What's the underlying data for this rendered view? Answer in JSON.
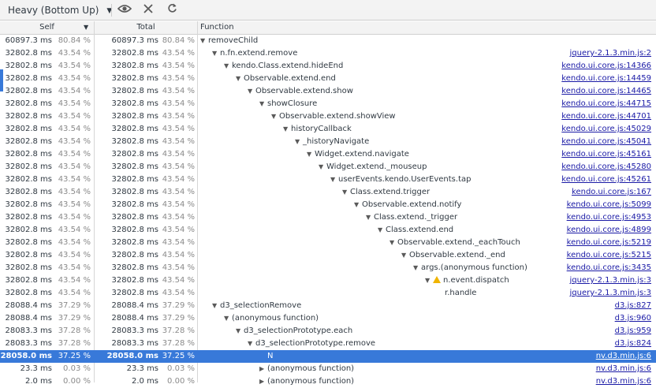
{
  "toolbar": {
    "view_select": "Heavy (Bottom Up)",
    "eye_icon": "eye-icon",
    "close_icon": "close-icon",
    "refresh_icon": "refresh-icon"
  },
  "columns": {
    "self": "Self",
    "total": "Total",
    "function": "Function"
  },
  "rows": [
    {
      "self_ms": "60897.3 ms",
      "self_pct": "80.84 %",
      "total_ms": "60897.3 ms",
      "total_pct": "80.84 %",
      "depth": 0,
      "arrow": "down",
      "name": "removeChild",
      "url": ""
    },
    {
      "self_ms": "32802.8 ms",
      "self_pct": "43.54 %",
      "total_ms": "32802.8 ms",
      "total_pct": "43.54 %",
      "depth": 1,
      "arrow": "down",
      "name": "n.fn.extend.remove",
      "url": "jquery-2.1.3.min.js:2"
    },
    {
      "self_ms": "32802.8 ms",
      "self_pct": "43.54 %",
      "total_ms": "32802.8 ms",
      "total_pct": "43.54 %",
      "depth": 2,
      "arrow": "down",
      "name": "kendo.Class.extend.hideEnd",
      "url": "kendo.ui.core.js:14366"
    },
    {
      "self_ms": "32802.8 ms",
      "self_pct": "43.54 %",
      "total_ms": "32802.8 ms",
      "total_pct": "43.54 %",
      "depth": 3,
      "arrow": "down",
      "name": "Observable.extend.end",
      "url": "kendo.ui.core.js:14459"
    },
    {
      "self_ms": "32802.8 ms",
      "self_pct": "43.54 %",
      "total_ms": "32802.8 ms",
      "total_pct": "43.54 %",
      "depth": 4,
      "arrow": "down",
      "name": "Observable.extend.show",
      "url": "kendo.ui.core.js:14465"
    },
    {
      "self_ms": "32802.8 ms",
      "self_pct": "43.54 %",
      "total_ms": "32802.8 ms",
      "total_pct": "43.54 %",
      "depth": 5,
      "arrow": "down",
      "name": "showClosure",
      "url": "kendo.ui.core.js:44715"
    },
    {
      "self_ms": "32802.8 ms",
      "self_pct": "43.54 %",
      "total_ms": "32802.8 ms",
      "total_pct": "43.54 %",
      "depth": 6,
      "arrow": "down",
      "name": "Observable.extend.showView",
      "url": "kendo.ui.core.js:44701"
    },
    {
      "self_ms": "32802.8 ms",
      "self_pct": "43.54 %",
      "total_ms": "32802.8 ms",
      "total_pct": "43.54 %",
      "depth": 7,
      "arrow": "down",
      "name": "historyCallback",
      "url": "kendo.ui.core.js:45029"
    },
    {
      "self_ms": "32802.8 ms",
      "self_pct": "43.54 %",
      "total_ms": "32802.8 ms",
      "total_pct": "43.54 %",
      "depth": 8,
      "arrow": "down",
      "name": "_historyNavigate",
      "url": "kendo.ui.core.js:45041"
    },
    {
      "self_ms": "32802.8 ms",
      "self_pct": "43.54 %",
      "total_ms": "32802.8 ms",
      "total_pct": "43.54 %",
      "depth": 9,
      "arrow": "down",
      "name": "Widget.extend.navigate",
      "url": "kendo.ui.core.js:45161"
    },
    {
      "self_ms": "32802.8 ms",
      "self_pct": "43.54 %",
      "total_ms": "32802.8 ms",
      "total_pct": "43.54 %",
      "depth": 10,
      "arrow": "down",
      "name": "Widget.extend._mouseup",
      "url": "kendo.ui.core.js:45280"
    },
    {
      "self_ms": "32802.8 ms",
      "self_pct": "43.54 %",
      "total_ms": "32802.8 ms",
      "total_pct": "43.54 %",
      "depth": 11,
      "arrow": "down",
      "name": "userEvents.kendo.UserEvents.tap",
      "url": "kendo.ui.core.js:45261"
    },
    {
      "self_ms": "32802.8 ms",
      "self_pct": "43.54 %",
      "total_ms": "32802.8 ms",
      "total_pct": "43.54 %",
      "depth": 12,
      "arrow": "down",
      "name": "Class.extend.trigger",
      "url": "kendo.ui.core.js:167"
    },
    {
      "self_ms": "32802.8 ms",
      "self_pct": "43.54 %",
      "total_ms": "32802.8 ms",
      "total_pct": "43.54 %",
      "depth": 13,
      "arrow": "down",
      "name": "Observable.extend.notify",
      "url": "kendo.ui.core.js:5099"
    },
    {
      "self_ms": "32802.8 ms",
      "self_pct": "43.54 %",
      "total_ms": "32802.8 ms",
      "total_pct": "43.54 %",
      "depth": 14,
      "arrow": "down",
      "name": "Class.extend._trigger",
      "url": "kendo.ui.core.js:4953"
    },
    {
      "self_ms": "32802.8 ms",
      "self_pct": "43.54 %",
      "total_ms": "32802.8 ms",
      "total_pct": "43.54 %",
      "depth": 15,
      "arrow": "down",
      "name": "Class.extend.end",
      "url": "kendo.ui.core.js:4899"
    },
    {
      "self_ms": "32802.8 ms",
      "self_pct": "43.54 %",
      "total_ms": "32802.8 ms",
      "total_pct": "43.54 %",
      "depth": 16,
      "arrow": "down",
      "name": "Observable.extend._eachTouch",
      "url": "kendo.ui.core.js:5219"
    },
    {
      "self_ms": "32802.8 ms",
      "self_pct": "43.54 %",
      "total_ms": "32802.8 ms",
      "total_pct": "43.54 %",
      "depth": 17,
      "arrow": "down",
      "name": "Observable.extend._end",
      "url": "kendo.ui.core.js:5215"
    },
    {
      "self_ms": "32802.8 ms",
      "self_pct": "43.54 %",
      "total_ms": "32802.8 ms",
      "total_pct": "43.54 %",
      "depth": 18,
      "arrow": "down",
      "name": "args.(anonymous function)",
      "url": "kendo.ui.core.js:3435"
    },
    {
      "self_ms": "32802.8 ms",
      "self_pct": "43.54 %",
      "total_ms": "32802.8 ms",
      "total_pct": "43.54 %",
      "depth": 19,
      "arrow": "down",
      "warn": true,
      "name": "n.event.dispatch",
      "url": "jquery-2.1.3.min.js:3"
    },
    {
      "self_ms": "32802.8 ms",
      "self_pct": "43.54 %",
      "total_ms": "32802.8 ms",
      "total_pct": "43.54 %",
      "depth": 20,
      "arrow": "none",
      "name": "r.handle",
      "url": "jquery-2.1.3.min.js:3"
    },
    {
      "self_ms": "28088.4 ms",
      "self_pct": "37.29 %",
      "total_ms": "28088.4 ms",
      "total_pct": "37.29 %",
      "depth": 1,
      "arrow": "down",
      "name": "d3_selectionRemove",
      "url": "d3.js:827"
    },
    {
      "self_ms": "28088.4 ms",
      "self_pct": "37.29 %",
      "total_ms": "28088.4 ms",
      "total_pct": "37.29 %",
      "depth": 2,
      "arrow": "down",
      "name": "(anonymous function)",
      "url": "d3.js:960"
    },
    {
      "self_ms": "28083.3 ms",
      "self_pct": "37.28 %",
      "total_ms": "28083.3 ms",
      "total_pct": "37.28 %",
      "depth": 3,
      "arrow": "down",
      "name": "d3_selectionPrototype.each",
      "url": "d3.js:959"
    },
    {
      "self_ms": "28083.3 ms",
      "self_pct": "37.28 %",
      "total_ms": "28083.3 ms",
      "total_pct": "37.28 %",
      "depth": 4,
      "arrow": "down",
      "name": "d3_selectionPrototype.remove",
      "url": "d3.js:824"
    },
    {
      "self_ms": "28058.0 ms",
      "self_pct": "37.25 %",
      "total_ms": "28058.0 ms",
      "total_pct": "37.25 %",
      "depth": 5,
      "arrow": "none",
      "name": "N",
      "url": "nv.d3.min.js:6",
      "selected": true
    },
    {
      "self_ms": "23.3 ms",
      "self_pct": "0.03 %",
      "total_ms": "23.3 ms",
      "total_pct": "0.03 %",
      "depth": 5,
      "arrow": "right",
      "name": "(anonymous function)",
      "url": "nv.d3.min.js:6"
    },
    {
      "self_ms": "2.0 ms",
      "self_pct": "0.00 %",
      "total_ms": "2.0 ms",
      "total_pct": "0.00 %",
      "depth": 5,
      "arrow": "right",
      "name": "(anonymous function)",
      "url": "nv.d3.min.js:6"
    }
  ]
}
